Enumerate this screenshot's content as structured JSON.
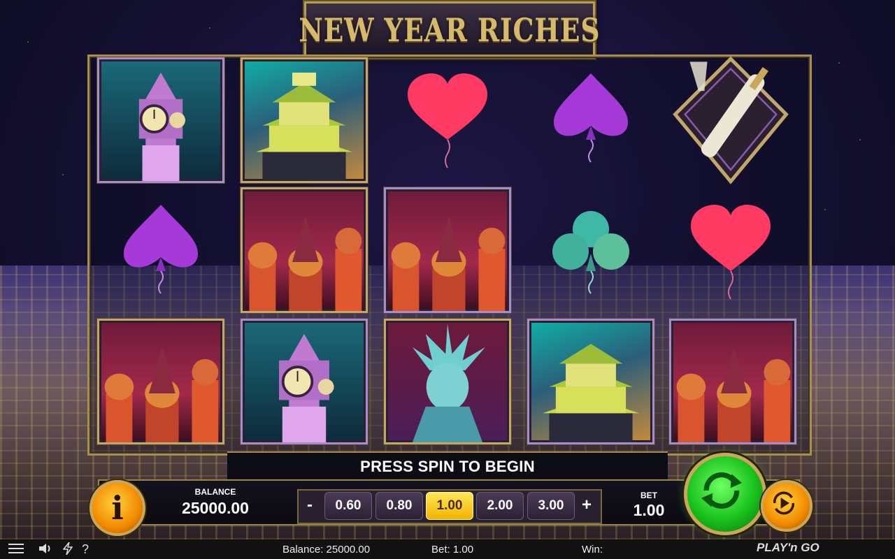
{
  "game": {
    "title": "NEW YEAR RICHES"
  },
  "reels": {
    "symbols": [
      [
        "bigben",
        "balloon-spade-purple",
        "basilica"
      ],
      [
        "castle",
        "basilica",
        "bigben"
      ],
      [
        "balloon-heart-red",
        "basilica",
        "liberty"
      ],
      [
        "balloon-spade-purple",
        "balloon-club-green",
        "castle"
      ],
      [
        "champagne",
        "balloon-heart-red",
        "basilica"
      ]
    ]
  },
  "message": "PRESS SPIN TO BEGIN",
  "controls": {
    "info_icon": "i",
    "balance_label": "BALANCE",
    "balance_value": "25000.00",
    "minus": "-",
    "plus": "+",
    "bet_options": [
      "0.60",
      "0.80",
      "1.00",
      "2.00",
      "3.00"
    ],
    "selected_bet": "1.00",
    "bet_label": "BET",
    "bet_value": "1.00"
  },
  "statusbar": {
    "menu_icon": "menu-icon",
    "sound_icon": "speaker-icon",
    "turbo_icon": "lightning-icon",
    "help": "?",
    "balance": "Balance: 25000.00",
    "bet": "Bet: 1.00",
    "win": "Win:",
    "brand": "PLAY'n GO"
  },
  "colors": {
    "gold": "#c3a66a",
    "spin": "#19c21c",
    "accent_orange": "#f28a00",
    "selected_chip": "#f2b400"
  }
}
